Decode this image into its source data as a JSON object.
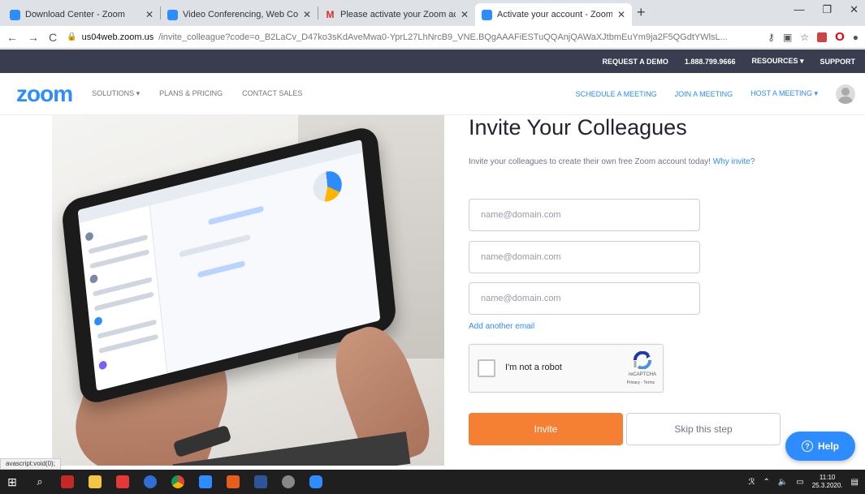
{
  "browser": {
    "tabs": [
      {
        "title": "Download Center - Zoom",
        "icon": "zoom-favicon"
      },
      {
        "title": "Video Conferencing, Web Confe",
        "icon": "zoom-favicon"
      },
      {
        "title": "Please activate your Zoom accou",
        "icon": "gmail-favicon"
      },
      {
        "title": "Activate your account - Zoom",
        "icon": "zoom-favicon"
      }
    ],
    "new_tab": "+",
    "url_host": "us04web.zoom.us",
    "url_rest": "/invite_colleague?code=o_B2LaCv_D47ko3sKdAveMwa0-YprL27LhNrcB9_VNE.BQgAAAFiESTuQQAnjQAWaXJtbmEuYm9ja2F5QGdtYWlsL...",
    "status_text": "avascript:void(0);"
  },
  "topbar": {
    "request_demo": "REQUEST A DEMO",
    "phone": "1.888.799.9666",
    "resources": "RESOURCES ▾",
    "support": "SUPPORT"
  },
  "header": {
    "logo": "zoom",
    "menu": [
      "SOLUTIONS ▾",
      "PLANS & PRICING",
      "CONTACT SALES"
    ],
    "right": [
      "SCHEDULE A MEETING",
      "JOIN A MEETING",
      "HOST A MEETING ▾"
    ]
  },
  "form": {
    "title": "Invite Your Colleagues",
    "description": "Invite your colleagues to create their own free Zoom account today!",
    "why_link": "Why invite?",
    "email_placeholder": "name@domain.com",
    "emails": [
      "",
      "",
      ""
    ],
    "add_email": "Add another email",
    "captcha_label": "I'm not a robot",
    "captcha_brand": "reCAPTCHA",
    "captcha_terms": "Privacy - Terms",
    "invite_button": "Invite",
    "skip_button": "Skip this step"
  },
  "help": {
    "label": "Help"
  },
  "taskbar": {
    "time": "11:10",
    "date": "25.3.2020."
  },
  "colors": {
    "zoom_blue": "#2d8cff",
    "invite_orange": "#f57f33",
    "topbar_bg": "#393d4f"
  }
}
